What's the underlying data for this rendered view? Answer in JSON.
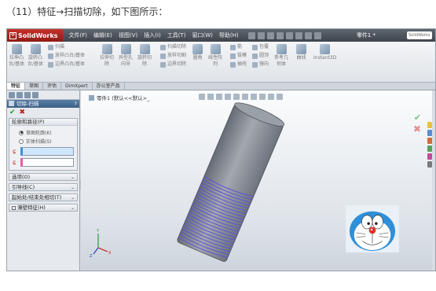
{
  "caption": "（11）特征→扫描切除，如下图所示：",
  "app": {
    "logo": "SolidWorks",
    "menu": [
      "文件(F)",
      "编辑(E)",
      "视图(V)",
      "插入(I)",
      "工具(T)",
      "窗口(W)",
      "帮助(H)"
    ],
    "doc_title": "零件1 *",
    "search_placeholder": "SolidWorks"
  },
  "ribbon": {
    "items": [
      {
        "label": "拉伸凸\n台/基体"
      },
      {
        "label": "旋转凸\n台/基体"
      },
      {
        "label": "扫描"
      },
      {
        "label": "放样凸台/基体"
      },
      {
        "label": "边界凸台/基体"
      },
      {
        "label": "拉伸切\n除"
      },
      {
        "label": "异型孔\n向导"
      },
      {
        "label": "旋转切\n除"
      },
      {
        "label": "扫描切除"
      },
      {
        "label": "放样切割"
      },
      {
        "label": "边界切除"
      },
      {
        "label": "圆角"
      },
      {
        "label": "线性阵\n列"
      },
      {
        "label": "筋"
      },
      {
        "label": "拔模"
      },
      {
        "label": "抽壳"
      },
      {
        "label": "包覆"
      },
      {
        "label": "圆顶"
      },
      {
        "label": "镜向"
      },
      {
        "label": "参考几\n何体"
      },
      {
        "label": "曲线"
      },
      {
        "label": "Instant3D"
      }
    ]
  },
  "tabs": [
    "特征",
    "草图",
    "评估",
    "DimXpert",
    "办公室产品"
  ],
  "pm": {
    "title": "切除-扫描",
    "help": "?",
    "groups": {
      "profile_path": {
        "label": "轮廓和路径(P)",
        "radio1": "草图轮廓(K)",
        "radio2": "实体扫描(S)"
      }
    },
    "collapsed": [
      "选项(O)",
      "引导线(C)",
      "起始处/结束处相切(T)",
      "薄壁特征(H)"
    ]
  },
  "viewport": {
    "tree_label": "零件1 (默认<<默认>_",
    "triad_axes": [
      "X",
      "Y",
      "Z"
    ]
  },
  "colors": {
    "title_bar": "#4a5058",
    "thread": "#5b4fe0",
    "cylinder": "#8a9099",
    "accent_blue": "#3f8fd8",
    "accent_pink": "#e85da5"
  }
}
